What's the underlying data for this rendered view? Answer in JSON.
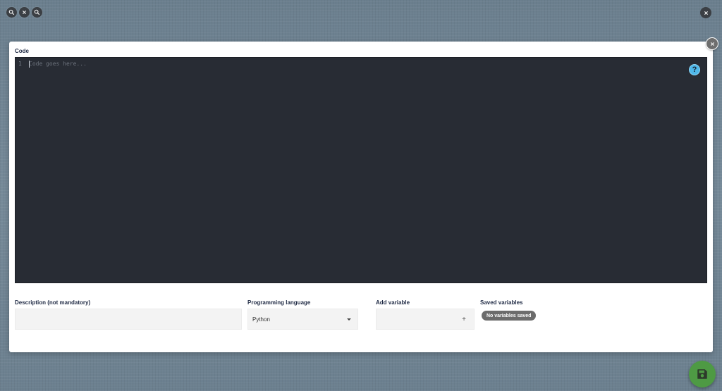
{
  "viewer": {
    "controls": [
      {
        "name": "zoom-out-icon"
      },
      {
        "name": "reset-zoom-icon"
      },
      {
        "name": "zoom-in-icon"
      }
    ],
    "close_icon": "close-icon"
  },
  "modal": {
    "close_icon": "close-icon",
    "code": {
      "label": "Code",
      "line_number": "1",
      "placeholder": "Code goes here...",
      "help_glyph": "?"
    },
    "description": {
      "label": "Description (not mandatory)",
      "value": ""
    },
    "programming_language": {
      "label": "Programming language",
      "selected": "Python"
    },
    "add_variable": {
      "label": "Add variable",
      "value": "",
      "add_glyph": "+"
    },
    "saved_variables": {
      "label": "Saved variables",
      "empty_badge": "No variables saved"
    }
  },
  "save_button": {
    "icon": "save-icon"
  },
  "colors": {
    "editor_bg": "#282c34",
    "help_blue": "#4fb8ea",
    "save_green": "#4e9a44",
    "badge_gray": "#6c6c6c",
    "label_navy": "#1f2a44"
  }
}
